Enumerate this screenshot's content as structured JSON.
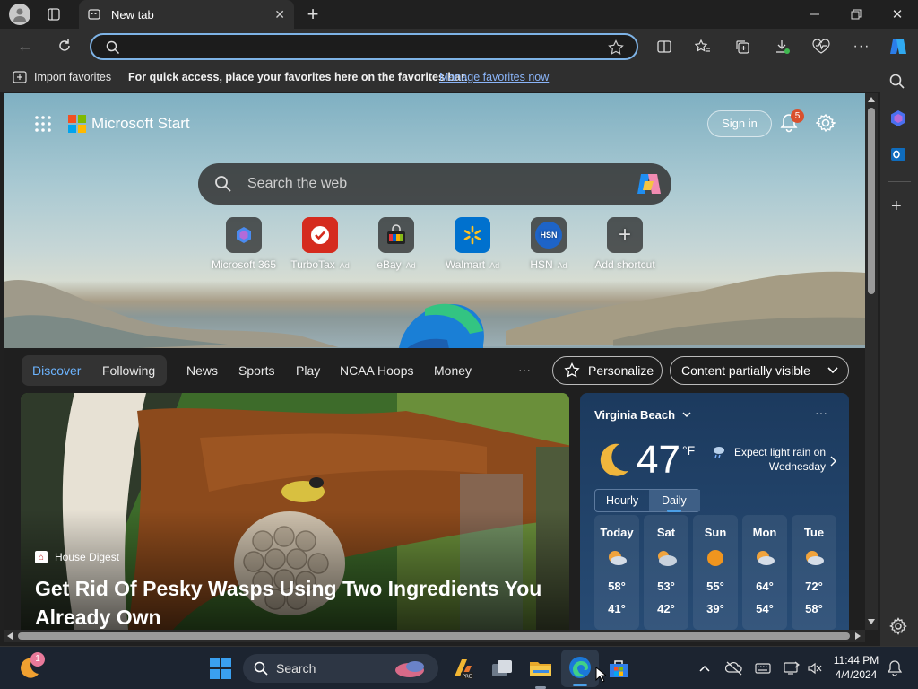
{
  "browser": {
    "tab_title": "New tab",
    "address_value": "",
    "favbar": {
      "import_label": "Import favorites",
      "hint": "For quick access, place your favorites here on the favorites bar.",
      "manage_link": "Manage favorites now"
    }
  },
  "start": {
    "brand": "Microsoft Start",
    "sign_in": "Sign in",
    "notif_count": "5",
    "search_placeholder": "Search the web",
    "shortcuts": [
      {
        "label": "Microsoft 365",
        "ad": ""
      },
      {
        "label": "TurboTax",
        "ad": "· Ad"
      },
      {
        "label": "eBay",
        "ad": "· Ad"
      },
      {
        "label": "Walmart",
        "ad": "· Ad"
      },
      {
        "label": "HSN",
        "ad": "· Ad"
      },
      {
        "label": "Add shortcut",
        "ad": ""
      }
    ],
    "hsn_logo": "HSN",
    "nav": {
      "discover": "Discover",
      "following": "Following",
      "news": "News",
      "sports": "Sports",
      "play": "Play",
      "ncaa": "NCAA Hoops",
      "money": "Money",
      "more": "···",
      "personalize": "Personalize",
      "content_visibility": "Content partially visible"
    },
    "article": {
      "source": "House Digest",
      "headline": "Get Rid Of Pesky Wasps Using Two Ingredients You Already Own"
    },
    "weather": {
      "location": "Virginia Beach",
      "temp": "47",
      "unit": "°F",
      "summary": "Expect light rain on Wednesday",
      "tab_hourly": "Hourly",
      "tab_daily": "Daily",
      "forecast": [
        {
          "day": "Today",
          "high": "58°",
          "low": "41°"
        },
        {
          "day": "Sat",
          "high": "53°",
          "low": "42°"
        },
        {
          "day": "Sun",
          "high": "55°",
          "low": "39°"
        },
        {
          "day": "Mon",
          "high": "64°",
          "low": "54°"
        },
        {
          "day": "Tue",
          "high": "72°",
          "low": "58°"
        }
      ]
    }
  },
  "taskbar": {
    "search_label": "Search",
    "widget_badge": "1",
    "time": "11:44 PM",
    "date": "4/4/2024"
  },
  "colors": {
    "accent": "#4ba0e8",
    "taskbar": "#1c2430",
    "link": "#8ab4f8"
  }
}
